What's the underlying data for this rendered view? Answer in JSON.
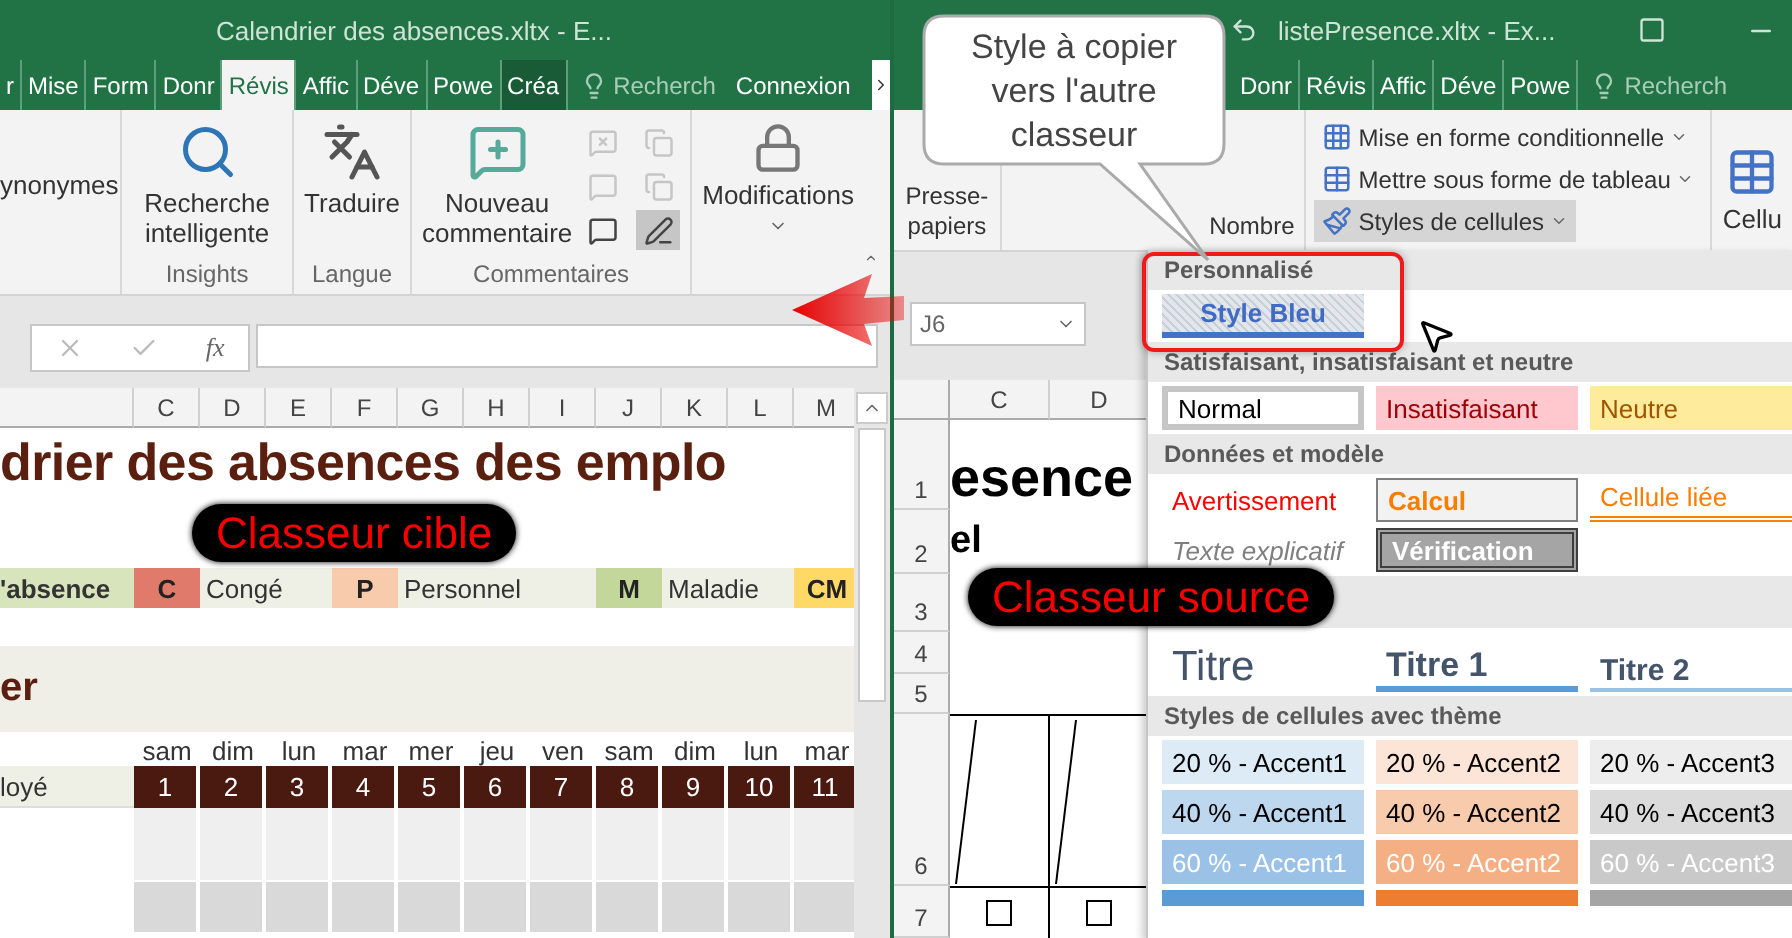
{
  "left_window": {
    "title": "Calendrier des absences.xltx - E...",
    "tabs": [
      {
        "label": "r",
        "selected": false,
        "kind": "normal"
      },
      {
        "label": "Mise",
        "selected": false,
        "kind": "normal"
      },
      {
        "label": "Form",
        "selected": false,
        "kind": "normal"
      },
      {
        "label": "Donr",
        "selected": false,
        "kind": "normal"
      },
      {
        "label": "Révis",
        "selected": true,
        "kind": "normal"
      },
      {
        "label": "Affic",
        "selected": false,
        "kind": "normal"
      },
      {
        "label": "Déve",
        "selected": false,
        "kind": "normal"
      },
      {
        "label": "Powe",
        "selected": false,
        "kind": "normal"
      },
      {
        "label": "Créa",
        "selected": false,
        "kind": "contextual"
      }
    ],
    "search": "Recherch",
    "account": "Connexion",
    "function_label": "fx",
    "ribbon": {
      "partial_button": "ynonymes",
      "smart_lookup": "Recherche intelligente",
      "insights": "Insights",
      "translate": "Traduire",
      "language": "Langue",
      "new_comment": "Nouveau commentaire",
      "comments": "Commentaires",
      "changes": "Modifications",
      "small_tools": [
        {
          "disabled": true,
          "pressed": false
        },
        {
          "disabled": true,
          "pressed": false
        },
        {
          "disabled": true,
          "pressed": false
        },
        {
          "disabled": true,
          "pressed": false
        },
        {
          "disabled": false,
          "pressed": false
        },
        {
          "disabled": false,
          "pressed": true
        }
      ]
    },
    "columns": [
      "C",
      "D",
      "E",
      "F",
      "G",
      "H",
      "I",
      "J",
      "K",
      "L",
      "M"
    ],
    "sheet_title": "drier des absences des emplo",
    "legend_label": "'absence",
    "legend": [
      {
        "code": "C",
        "color": "#e07a6a",
        "text": "Congé"
      },
      {
        "code": "P",
        "color": "#f8cbad",
        "text": "Personnel"
      },
      {
        "code": "M",
        "color": "#c4d79b",
        "text": "Maladie"
      },
      {
        "code": "CM",
        "color": "#ffd966"
      }
    ],
    "section_title": "er",
    "day_names": [
      "sam",
      "dim",
      "lun",
      "mar",
      "mer",
      "jeu",
      "ven",
      "sam",
      "dim",
      "lun",
      "mar"
    ],
    "employee_header": "loyé",
    "days": [
      "1",
      "2",
      "3",
      "4",
      "5",
      "6",
      "7",
      "8",
      "9",
      "10",
      "11"
    ]
  },
  "right_window": {
    "title": "listePresence.xltx - Ex...",
    "tabs": [
      {
        "label": "Donr",
        "selected": false
      },
      {
        "label": "Révis",
        "selected": false
      },
      {
        "label": "Affic",
        "selected": false
      },
      {
        "label": "Déve",
        "selected": false
      },
      {
        "label": "Powe",
        "selected": false
      }
    ],
    "search": "Recherch",
    "ribbon": {
      "clipboard": "Presse-papiers",
      "number": "Nombre",
      "styles": [
        {
          "label": "Mise en forme conditionnelle",
          "selected": false
        },
        {
          "label": "Mettre sous forme de tableau",
          "selected": false
        },
        {
          "label": "Styles de cellules",
          "selected": true
        }
      ],
      "cells": "Cellu"
    },
    "name_box": "J6",
    "columns": [
      "C",
      "D"
    ],
    "rows": [
      "1",
      "2",
      "3",
      "4",
      "5",
      "6",
      "7"
    ],
    "cell_title": "esence",
    "cell_subtitle": "el",
    "checkboxes": [
      {
        "checked": false
      },
      {
        "checked": false
      }
    ]
  },
  "gallery": {
    "sections": [
      {
        "heading": "Personnalisé",
        "items": [
          {
            "label": "Style Bleu",
            "kind": "custom"
          }
        ]
      },
      {
        "heading": "Satisfaisant, insatisfaisant et neutre",
        "items": [
          {
            "label": "Normal",
            "kind": "normal"
          },
          {
            "label": "Insatisfaisant",
            "kind": "bad"
          },
          {
            "label": "Neutre",
            "kind": "neutral"
          }
        ]
      },
      {
        "heading": "Données et modèle",
        "items": [
          {
            "label": "Avertissement",
            "kind": "warning"
          },
          {
            "label": "Calcul",
            "kind": "calc"
          },
          {
            "label": "Cellule liée",
            "kind": "linked"
          },
          {
            "label": "Texte explicatif",
            "kind": "note"
          },
          {
            "label": "Vérification",
            "kind": "check"
          }
        ]
      },
      {
        "items": [
          {
            "label": "Titre",
            "kind": "title"
          },
          {
            "label": "Titre 1",
            "kind": "heading1"
          },
          {
            "label": "Titre 2",
            "kind": "heading2"
          }
        ]
      },
      {
        "heading": "Styles de cellules avec thème",
        "items": [
          {
            "label": "20 % - Accent1",
            "kind": "accent",
            "color": "#ddebf7"
          },
          {
            "label": "20 % - Accent2",
            "kind": "accent",
            "color": "#fce4d6"
          },
          {
            "label": "20 % - Accent3",
            "kind": "accent",
            "color": "#ededed"
          },
          {
            "label": "40 % - Accent1",
            "kind": "accent",
            "color": "#bdd7ee"
          },
          {
            "label": "40 % - Accent2",
            "kind": "accent",
            "color": "#f8cbad"
          },
          {
            "label": "40 % - Accent3",
            "kind": "accent",
            "color": "#dbdbdb"
          },
          {
            "label": "60 % - Accent1",
            "kind": "strong",
            "color": "#9bc2e6"
          },
          {
            "label": "60 % - Accent2",
            "kind": "strong",
            "color": "#f4b084"
          },
          {
            "label": "60 % - Accent3",
            "kind": "strong",
            "color": "#c9c9c9"
          },
          {
            "kind": "swatch",
            "color": "#5b9bd5"
          },
          {
            "kind": "swatch",
            "color": "#ed7d31"
          },
          {
            "kind": "swatch",
            "color": "#a5a5a5"
          }
        ]
      }
    ]
  },
  "annotations": {
    "callout": "Style à copier vers l'autre classeur",
    "target_label": "Classeur cible",
    "source_label": "Classeur source"
  }
}
